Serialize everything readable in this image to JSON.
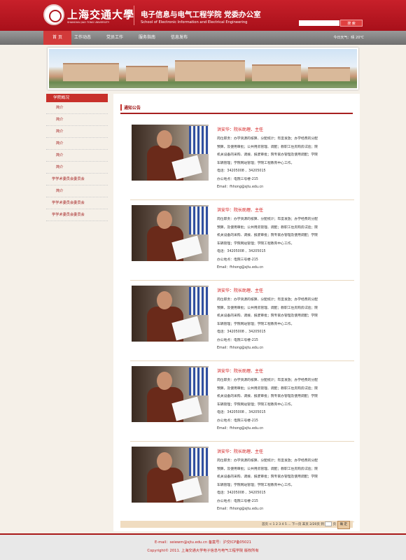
{
  "header": {
    "logo_cn": "上海交通大學",
    "logo_en": "SHANGHAI JIAO TONG UNIVERSITY",
    "school_cn": "电子信息与电气工程学院  党委办公室",
    "school_en": "School of Electronic Information and Electrical Engineering",
    "search_placeholder": "",
    "search_label": "搜 索"
  },
  "nav": {
    "items": [
      "首 页",
      "工作动态",
      "党员工作",
      "服务指南",
      "信息发布"
    ],
    "weather": "今日天气：晴 20℃"
  },
  "sidebar": {
    "title": "学院概况",
    "items": [
      "简介",
      "简介",
      "简介",
      "简介",
      "简介",
      "简介",
      "学学术委员会委员会",
      "简介",
      "学学术委员会委员会",
      "学学术委员会委员会"
    ]
  },
  "main": {
    "title": "通知公告",
    "entries": [
      {
        "name": "洪安华：院长助理、主任",
        "duties1": "岗位职责：办学资源的核算、分配统计；年度发放；办学经费的分配",
        "duties2": "预算，及使用审批；公共用房管理、调配；教职工住房购房试验；院",
        "duties3": "机关设备的采购、调拨、报废审批；院专家办管理及使用调配；学院",
        "duties4": "车辆管理；学院网站管理；学院工程教育中心工作。",
        "phone": "电话：34205008 、34205015",
        "office": "办公地点：电院三号楼-215",
        "email": "Email：fhhong@sjtu.edu.cn"
      },
      {
        "name": "洪安华：院长助理、主任",
        "duties1": "岗位职责：办学资源的核算、分配统计；年度发放；办学经费的分配",
        "duties2": "预算，及使用审批；公共用房管理、调配；教职工住房购房试验；院",
        "duties3": "机关设备的采购、调拨、报废审批；院专家办管理及使用调配；学院",
        "duties4": "车辆管理；学院网站管理；学院工程教育中心工作。",
        "phone": "电话：34205008 、34205015",
        "office": "办公地点：电院三号楼-215",
        "email": "Email：fhhong@sjtu.edu.cn"
      },
      {
        "name": "洪安华：院长助理、主任",
        "duties1": "岗位职责：办学资源的核算、分配统计；年度发放；办学经费的分配",
        "duties2": "预算，及使用审批；公共用房管理、调配；教职工住房购房试验；院",
        "duties3": "机关设备的采购、调拨、报废审批；院专家办管理及使用调配；学院",
        "duties4": "车辆管理；学院网站管理；学院工程教育中心工作。",
        "phone": "电话：34205008 、34205015",
        "office": "办公地点：电院三号楼-215",
        "email": "Email：fhhong@sjtu.edu.cn"
      },
      {
        "name": "洪安华：院长助理、主任",
        "duties1": "岗位职责：办学资源的核算、分配统计；年度发放；办学经费的分配",
        "duties2": "预算，及使用审批；公共用房管理、调配；教职工住房购房试验；院",
        "duties3": "机关设备的采购、调拨、报废审批；院专家办管理及使用调配；学院",
        "duties4": "车辆管理；学院网站管理；学院工程教育中心工作。",
        "phone": "电话：34205008 、34205015",
        "office": "办公地点：电院三号楼-215",
        "email": "Email：fhhong@sjtu.edu.cn"
      },
      {
        "name": "洪安华：院长助理、主任",
        "duties1": "岗位职责：办学资源的核算、分配统计；年度发放；办学经费的分配",
        "duties2": "预算，及使用审批；公共用房管理、调配；教职工住房购房试验；院",
        "duties3": "机关设备的采购、调拨、报废审批；院专家办管理及使用调配；学院",
        "duties4": "车辆管理；学院网站管理；学院工程教育中心工作。",
        "phone": "电话：34205008 、34205015",
        "office": "办公地点：电院三号楼-215",
        "email": "Email：fhhong@sjtu.edu.cn"
      }
    ]
  },
  "pager": {
    "text": "首页 < 1 2 3 4 5 ... 下一页 末页 2/20页 到",
    "page_suffix": "页",
    "go_label": "确 定"
  },
  "footer": {
    "line1": "E-mail：seiewm@sjtu.edu.cn 备案号：沪交ICP备05021",
    "line2": "Copyright© 2011. 上海交通大学电子信息与电气工程学院 版权所有"
  },
  "colors": {
    "brand_red": "#c8202a",
    "nav_gray": "#7a7a7a",
    "accent_red": "#a82020"
  }
}
